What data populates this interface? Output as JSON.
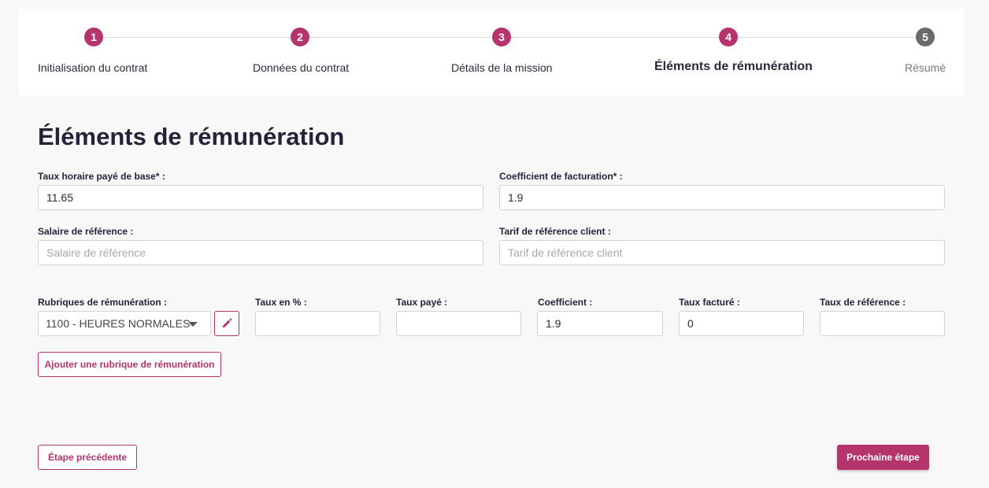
{
  "stepper": {
    "steps": [
      {
        "number": "1",
        "label": "Initialisation du contrat"
      },
      {
        "number": "2",
        "label": "Données du contrat"
      },
      {
        "number": "3",
        "label": "Détails de la mission"
      },
      {
        "number": "4",
        "label": "Éléments de rémunération"
      },
      {
        "number": "5",
        "label": "Résumé"
      }
    ],
    "active_step": 4,
    "colors": {
      "done": "#b5346b",
      "pending": "#6b6b6b"
    }
  },
  "page": {
    "title": "Éléments de rémunération"
  },
  "form": {
    "base_rate": {
      "label": "Taux horaire payé de base* :",
      "value": "11.65"
    },
    "billing_coef": {
      "label": "Coefficient de facturation* :",
      "value": "1.9"
    },
    "ref_salary": {
      "label": "Salaire de référence :",
      "value": "",
      "placeholder": "Salaire de référence"
    },
    "client_ref_rate": {
      "label": "Tarif de référence client :",
      "value": "",
      "placeholder": "Tarif de référence client"
    }
  },
  "rubrics": {
    "headers": {
      "rubric": "Rubriques de rémunération :",
      "rate_percent": "Taux en % :",
      "paid_rate": "Taux payé :",
      "coefficient": "Coefficient :",
      "billed_rate": "Taux facturé :",
      "ref_rate": "Taux de référence :"
    },
    "row": {
      "rubric": "1100 - HEURES NORMALES",
      "rate_percent": "",
      "paid_rate": "",
      "coefficient": "1.9",
      "billed_rate": "0",
      "ref_rate": ""
    },
    "add_label": "Ajouter une rubrique de rémunération"
  },
  "footer": {
    "previous_label": "Étape précédente",
    "next_label": "Prochaine étape"
  },
  "accent_color": "#b5346b"
}
